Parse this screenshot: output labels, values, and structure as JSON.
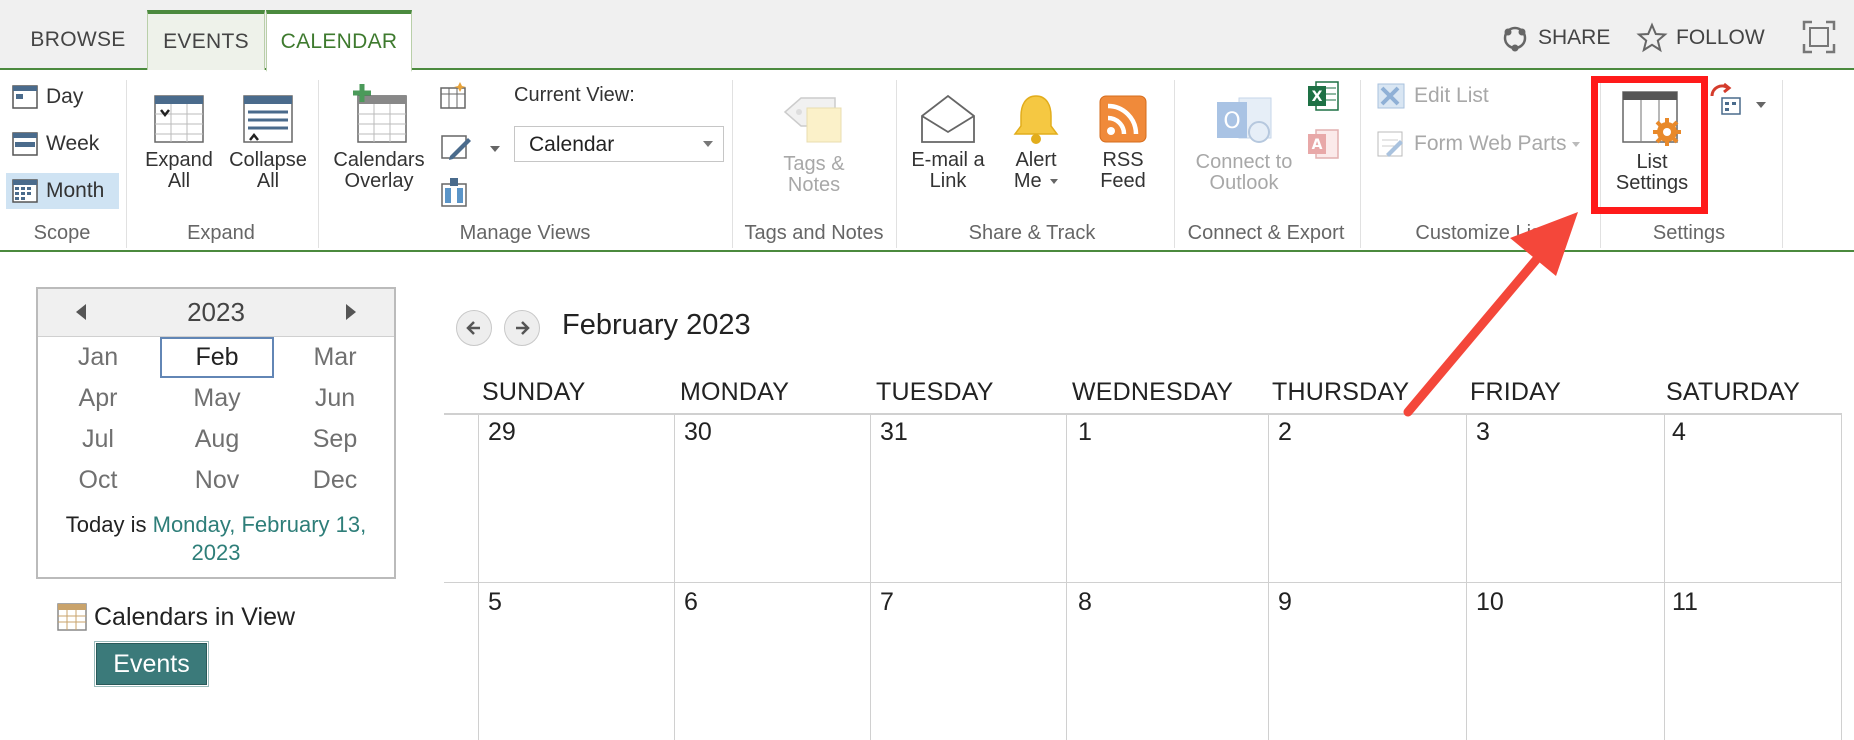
{
  "tabs": {
    "browse": "BROWSE",
    "events": "EVENTS",
    "calendar": "CALENDAR"
  },
  "top_actions": {
    "share": "SHARE",
    "follow": "FOLLOW"
  },
  "ribbon": {
    "scope": {
      "label": "Scope",
      "day": "Day",
      "week": "Week",
      "month": "Month",
      "selected": "Month"
    },
    "expand": {
      "label": "Expand",
      "expand_all_1": "Expand",
      "expand_all_2": "All",
      "collapse_all_1": "Collapse",
      "collapse_all_2": "All"
    },
    "manage_views": {
      "label": "Manage Views",
      "overlay_1": "Calendars",
      "overlay_2": "Overlay",
      "current_view_label": "Current View:",
      "current_view_value": "Calendar"
    },
    "tags_notes": {
      "label": "Tags and Notes",
      "btn_1": "Tags &",
      "btn_2": "Notes"
    },
    "share_track": {
      "label": "Share & Track",
      "email_1": "E-mail a",
      "email_2": "Link",
      "alert_1": "Alert",
      "alert_2": "Me",
      "rss_1": "RSS",
      "rss_2": "Feed"
    },
    "connect_export": {
      "label": "Connect & Export",
      "outlook_1": "Connect to",
      "outlook_2": "Outlook"
    },
    "customize_list": {
      "label": "Customize List",
      "edit_list": "Edit List",
      "form_web_parts": "Form Web Parts"
    },
    "settings": {
      "label": "Settings",
      "list_settings_1": "List",
      "list_settings_2": "Settings"
    }
  },
  "date_picker": {
    "year": "2023",
    "months": [
      "Jan",
      "Feb",
      "Mar",
      "Apr",
      "May",
      "Jun",
      "Jul",
      "Aug",
      "Sep",
      "Oct",
      "Nov",
      "Dec"
    ],
    "selected_month": "Feb",
    "today_prefix": "Today is",
    "today_date_1": "Monday, February 13,",
    "today_date_2": "2023"
  },
  "calendars_in_view": {
    "title": "Calendars in View",
    "items": [
      "Events"
    ]
  },
  "calendar": {
    "title": "February 2023",
    "days_of_week": [
      "SUNDAY",
      "MONDAY",
      "TUESDAY",
      "WEDNESDAY",
      "THURSDAY",
      "FRIDAY",
      "SATURDAY"
    ],
    "weeks": [
      [
        "29",
        "30",
        "31",
        "1",
        "2",
        "3",
        "4"
      ],
      [
        "5",
        "6",
        "7",
        "8",
        "9",
        "10",
        "11"
      ]
    ]
  },
  "colors": {
    "accent_green": "#4b8a3e",
    "highlight_red": "#ff1a1a",
    "events_teal": "#3b7a7a",
    "selected_blue": "#cfe3f3"
  }
}
